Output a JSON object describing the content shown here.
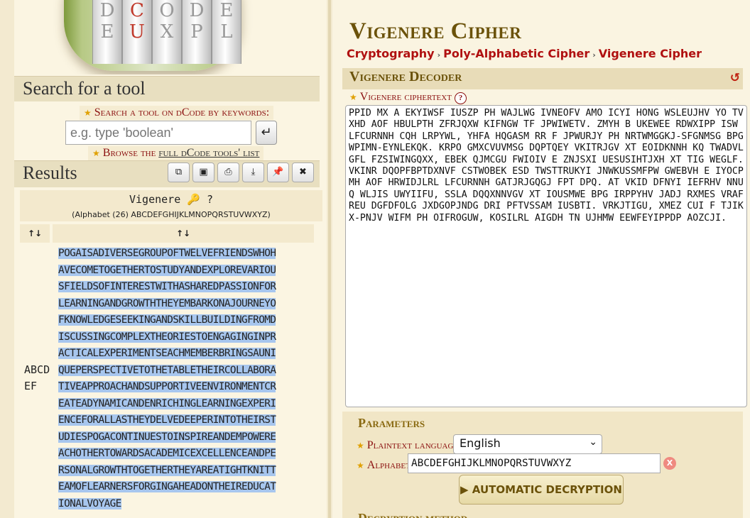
{
  "logo": {
    "letters": [
      "D",
      "C",
      "O",
      "D",
      "E"
    ],
    "lower_letters": [
      "E",
      "U",
      "X",
      "P",
      "L"
    ]
  },
  "left": {
    "search_title": "Search for a tool",
    "search_label": "Search a tool on dCode by keywords:",
    "search_placeholder": "e.g. type 'boolean'",
    "search_go_icon": "↵",
    "browse_prefix": "Browse the ",
    "browse_link": "full dCode tools' list",
    "results_title": "Results",
    "result_tools": [
      "copy-icon",
      "screenshot-icon",
      "print-icon",
      "download-icon",
      "pin-icon",
      "close-icon"
    ],
    "result_name": "Vigenere 🔑 ?",
    "result_alphabet": "(Alphabet (26) ABCDEFGHIJKLMNOPQRSTUVWXYZ)",
    "col_key_header": "↑↓",
    "col_text_header": "↑↓",
    "key_lines": [
      "ABCD",
      "EF"
    ],
    "plaintext_lines": [
      "POGAISADIVERSEGROUPOFTWELVEFRIENDSWHOH",
      "AVECOMETOGETHERTOSTUDYANDEXPLOREVARIOU",
      "SFIELDSOFINTERESTWITHASHAREDPASSIONFOR",
      "LEARNINGANDGROWTHTHEYEMBARKONAJOURNEYO",
      "FKNOWLEDGESEEKINGANDSKILLBUILDINGFROMD",
      "ISCUSSINGCOMPLEXTHEORIESTOENGAGINGINPR",
      "ACTICALEXPERIMENTSEACHMEMBERBRINGSAUNI",
      "QUEPERSPECTIVETOTHETABLETHEIRCOLLABORA",
      "TIVEAPPROACHANDSUPPORTIVEENVIRONMENTCR",
      "EATEADYNAMICANDENRICHINGLEARNINGEXPERI",
      "ENCEFORALLASTHEYDELVEDEEPERINTOTHEIRST",
      "UDIESPOGACONTINUESTOINSPIREANDEMPOWERE",
      "ACHOTHERTOWARDSACADEMICEXCELLENCEANDPE",
      "RSONALGROWTHTOGETHERTHEYAREATIGHTKNITT",
      "EAMOFLEARNERSFORGINGAHEADONTHEIREDUCAT",
      "IONALVOYAGE"
    ]
  },
  "right": {
    "page_title": "Vigenere Cipher",
    "breadcrumb": [
      "Cryptography",
      "Poly-Alphabetic Cipher",
      "Vigenere Cipher"
    ],
    "breadcrumb_sep": "›",
    "decoder_title": "Vigenere Decoder",
    "refresh_icon": "↺",
    "cipher_label": "Vigenere ciphertext",
    "help": "?",
    "ciphertext": "PPID MX A EKYIWSF IUSZP PH WAJLWG IVNEOFV AMO ICYI HONG WSLEUJHV YO TVXHD AOF HBULPTH ZFRJQXW KIFNGW TF JPWIWETV. ZMYH B UKEWEE RDWXIPP ISW LFCURNNH CQH LRPYWL, YHFA HQGASM RR F JPWURJY PH NRTWMGGKJ-SFGNMSG BPG WPIMN-EYNLEKQK. KRPO GMXCVUVMSG DQPTQEY VKITRJGV XT EOIDKNNH KQ TWADVLGFL FZSIWINGQXX, EBEK QJMCGU FWIOIV E ZNJSXI UESUSIHTJXH XT TIG WEGLF. VKINR DQOPFBPTDXNVF CSTWOBEK ESD TWSTTRUKYI JNWKUSSMFPW GWEBVH E IYOCPMH AOF HRWIDJLRL LFCURNNH GATJRJGQGJ FPT DPQ. AT VKID DFNYI IEFRHV NNUQ WLJIS UWYIIFU, SSLA DQQXNNVGV XT IOUSMWE BPG IRPPYHV JADJ RXMES VRAFREU DGFDFOLG JXDGOPJNDG DRI PFTVSSAM IUSBTI. VRKJTIGU, XMEZ CUI F TJIKX-PNJV WIFM PH OIFROGUW, KOSILRL AIGDH TN UJHMW EEWFEYIPPDP AOZCJI.",
    "params_title": "Parameters",
    "lang_label": "Plaintext language",
    "lang_value": "English",
    "alpha_label": "Alphabet",
    "alpha_value": "ABCDEFGHIJKLMNOPQRSTUVWXYZ",
    "alpha_clear": "X",
    "auto_button": "▶ AUTOMATIC DECRYPTION",
    "method_title": "Decryption method"
  },
  "colors": {
    "accent_red": "#b01010",
    "title_brown": "#6b520a",
    "selection_blue": "#a7c6ee"
  }
}
